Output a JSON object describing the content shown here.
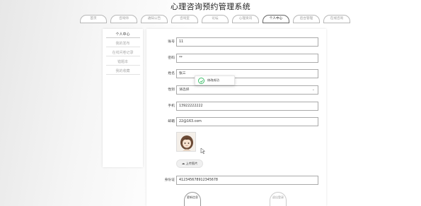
{
  "site": {
    "title": "心理咨询预约管理系统"
  },
  "nav": {
    "items": [
      "首页",
      "咨询师",
      "通知公告",
      "咨询室",
      "论坛",
      "心理资讯",
      "个人中心",
      "后台管理",
      "在线咨询"
    ],
    "active_index": 6
  },
  "sidebar": {
    "items": [
      "个人中心",
      "我的发布",
      "在线问卷记录",
      "错题本",
      "我的收藏"
    ],
    "active_index": 0
  },
  "form": {
    "account": {
      "label": "账号",
      "value": "11"
    },
    "password": {
      "label": "密码",
      "value": "**"
    },
    "name": {
      "label": "姓名",
      "value": "张三"
    },
    "gender": {
      "label": "性别",
      "value": "请选择"
    },
    "phone": {
      "label": "手机",
      "value": "13922222222"
    },
    "email": {
      "label": "邮箱",
      "value": "22@163.com"
    },
    "upload_label": "上传图片",
    "id_card": {
      "label": "身份证",
      "value": "412345678912345678"
    }
  },
  "toast": {
    "message": "修改成功"
  },
  "buttons": {
    "update": "更新信息",
    "logout": "退出登录"
  },
  "colors": {
    "success": "#3fbf6c",
    "border": "#aaaaaa"
  },
  "icons": {
    "upload": "cloud-upload-icon",
    "toast": "check-circle-icon",
    "select": "chevron-down-icon"
  }
}
